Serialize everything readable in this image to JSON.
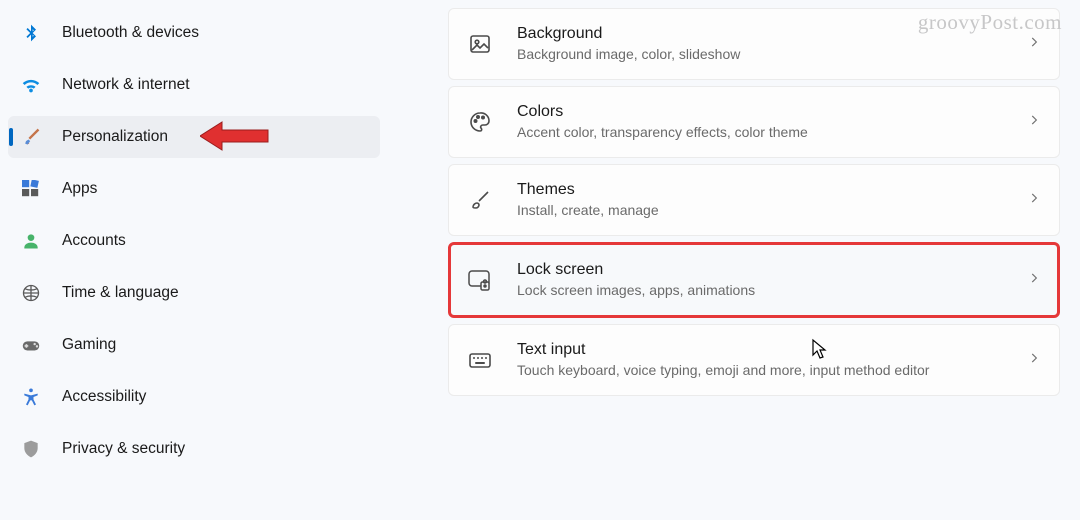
{
  "watermark": "groovyPost.com",
  "sidebar": {
    "items": [
      {
        "label": "Bluetooth & devices",
        "icon": "bluetooth-icon"
      },
      {
        "label": "Network & internet",
        "icon": "wifi-icon"
      },
      {
        "label": "Personalization",
        "icon": "paintbrush-icon",
        "active": true
      },
      {
        "label": "Apps",
        "icon": "apps-icon"
      },
      {
        "label": "Accounts",
        "icon": "person-icon"
      },
      {
        "label": "Time & language",
        "icon": "clock-globe-icon"
      },
      {
        "label": "Gaming",
        "icon": "gamepad-icon"
      },
      {
        "label": "Accessibility",
        "icon": "accessibility-icon"
      },
      {
        "label": "Privacy & security",
        "icon": "shield-icon"
      }
    ]
  },
  "cards": [
    {
      "title": "Background",
      "subtitle": "Background image, color, slideshow",
      "icon": "image-icon"
    },
    {
      "title": "Colors",
      "subtitle": "Accent color, transparency effects, color theme",
      "icon": "palette-icon"
    },
    {
      "title": "Themes",
      "subtitle": "Install, create, manage",
      "icon": "brush-icon"
    },
    {
      "title": "Lock screen",
      "subtitle": "Lock screen images, apps, animations",
      "icon": "lockscreen-icon",
      "highlighted": true
    },
    {
      "title": "Text input",
      "subtitle": "Touch keyboard, voice typing, emoji and more, input method editor",
      "icon": "keyboard-icon"
    }
  ]
}
